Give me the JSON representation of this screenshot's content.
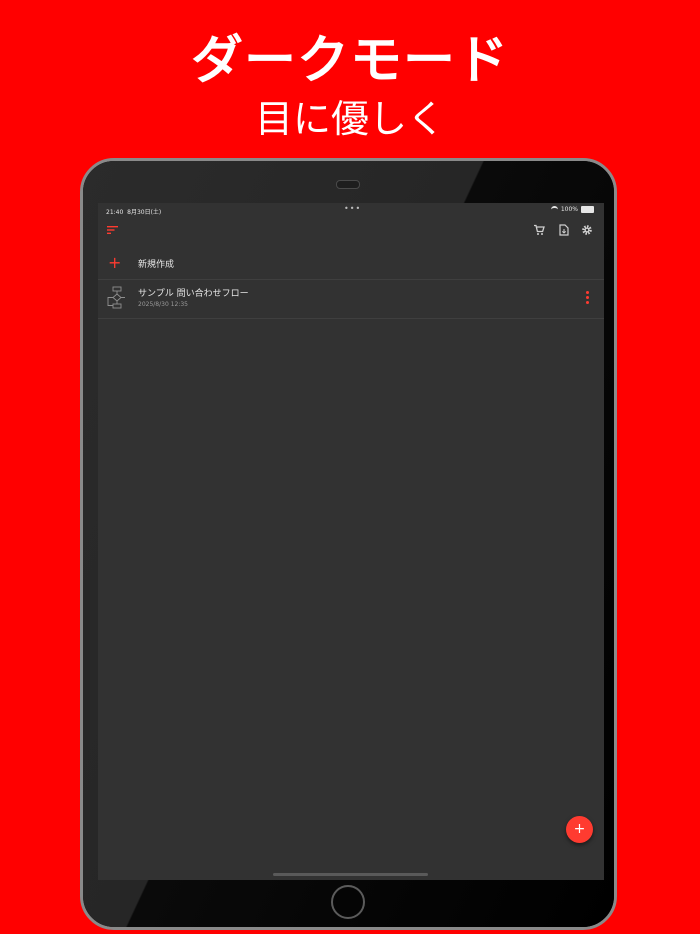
{
  "promo": {
    "headline": "ダークモード",
    "subline": "目に優しく"
  },
  "status_bar": {
    "time": "21:40",
    "date": "8月30日(土)",
    "dots": "•••",
    "battery": "100%"
  },
  "toolbar": {
    "icons": [
      "sort-icon",
      "cart-icon",
      "import-file-icon",
      "gear-icon"
    ]
  },
  "list": {
    "new_label": "新規作成",
    "items": [
      {
        "title": "サンプル 問い合わせフロー",
        "date": "2025/8/30 12:35"
      }
    ]
  },
  "fab_label": "+",
  "colors": {
    "accent": "#ff3b30",
    "background": "#ff0000",
    "screen": "#323232"
  }
}
